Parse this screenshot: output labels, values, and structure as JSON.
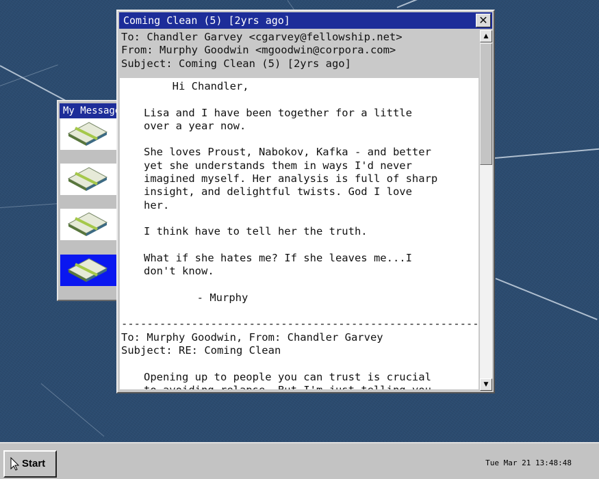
{
  "message_list_window": {
    "title": "My Messages",
    "items": [
      {
        "icon": "envelope-icon",
        "selected": false
      },
      {
        "icon": "envelope-icon",
        "selected": false
      },
      {
        "icon": "envelope-icon",
        "selected": false
      },
      {
        "icon": "envelope-icon",
        "selected": true
      }
    ]
  },
  "email_window": {
    "title": "Coming Clean (5) [2yrs ago]",
    "close_label": "✕",
    "header": {
      "to": "To: Chandler Garvey <cgarvey@fellowship.net>",
      "from": "From: Murphy Goodwin <mgoodwin@corpora.com>",
      "subject": "Subject: Coming Clean (5) [2yrs ago]"
    },
    "body": {
      "greeting": "        Hi Chandler,",
      "p1": [
        "Lisa and I have been together for a little",
        "over a year now."
      ],
      "p2": [
        "She loves Proust, Nabokov, Kafka - and better",
        "yet she understands them in ways I'd never",
        "imagined myself. Her analysis is full of sharp",
        "insight, and delightful twists. God I love",
        "her."
      ],
      "p3": [
        "I think have to tell her the truth."
      ],
      "p4": [
        "What if she hates me? If she leaves me...I",
        "don't know."
      ],
      "signoff": "        - Murphy",
      "separator": "---------------------------------------------------------------------",
      "reply_header": [
        "To: Murphy Goodwin, From: Chandler Garvey",
        "Subject: RE: Coming Clean"
      ],
      "reply_p1": [
        "Opening up to people you can trust is crucial",
        "to avoiding relapse. But I'm just telling you"
      ]
    },
    "scroll_up": "▲",
    "scroll_down": "▼"
  },
  "taskbar": {
    "start_label": "Start",
    "clock": "Tue Mar 21 13:48:48"
  },
  "colors": {
    "desktop": "#2b4b6f",
    "titlebar": "#1d2d99",
    "selection": "#0a17f0",
    "window_face": "#c9c9c9"
  }
}
